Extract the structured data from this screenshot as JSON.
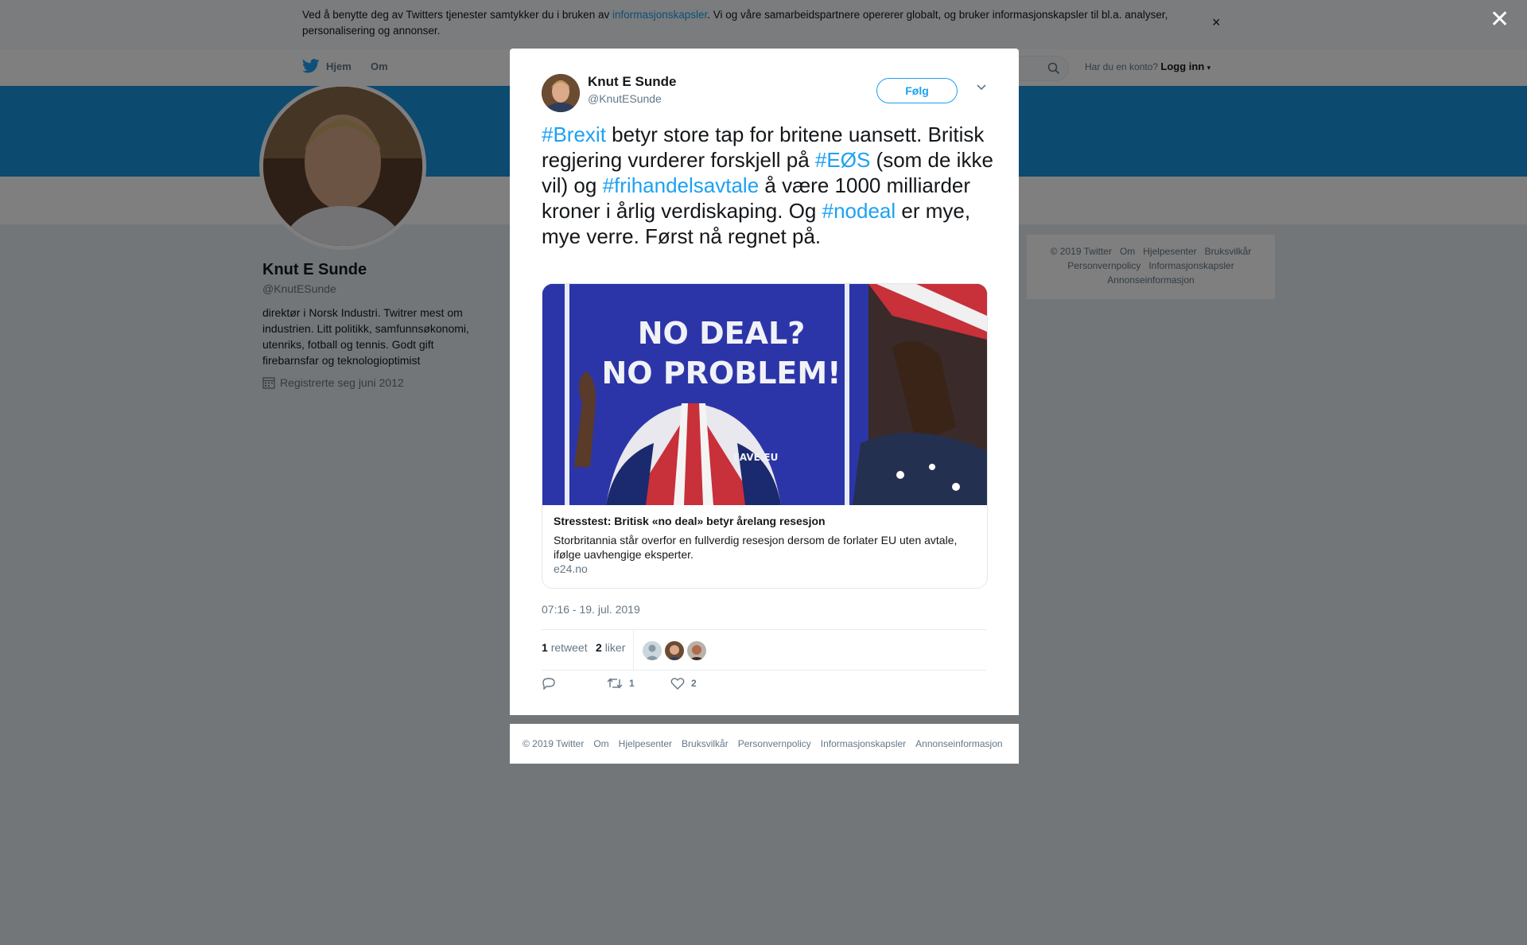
{
  "cookie_bar": {
    "text_before": "Ved å benytte deg av Twitters tjenester samtykker du i bruken av ",
    "link": "informasjonskapsler",
    "text_after": ". Vi og våre samarbeidspartnere opererer globalt, og bruker informasjonskapsler til bl.a. analyser, personalisering og annonser.",
    "close": "×"
  },
  "topnav": {
    "home": "Hjem",
    "about": "Om",
    "account_prompt": "Har du en konto?",
    "login": "Logg inn"
  },
  "profile": {
    "name": "Knut E Sunde",
    "handle": "@KnutESunde",
    "bio": "direktør i Norsk Industri. Twitrer mest om industrien. Litt politikk, samfunnsøkonomi, utenriks, fotball og tennis. Godt gift firebarnsfar og teknologioptimist",
    "joined": "Registrerte seg juni 2012"
  },
  "side_footer": {
    "links": [
      "© 2019 Twitter",
      "Om",
      "Hjelpesenter",
      "Bruksvilkår",
      "Personvernpolicy",
      "Informasjonskapsler",
      "Annonseinformasjon"
    ]
  },
  "overlay": {
    "close": "✕"
  },
  "tweet": {
    "author_name": "Knut E Sunde",
    "author_handle": "@KnutESunde",
    "follow_label": "Følg",
    "text_parts": {
      "h1": "#Brexit",
      "t1": " betyr store tap for britene uansett. Britisk regjering vurderer forskjell på ",
      "h2": "#EØS",
      "t2": " (som de ikke vil) og ",
      "h3": "#frihandelsavtale",
      "t3": " å være 1000 milliarder kroner i årlig verdiskaping. Og ",
      "h4": "#nodeal",
      "t4": " er mye, mye verre. Først nå regnet på."
    },
    "card": {
      "image_line1": "NO DEAL?",
      "image_line2": "NO PROBLEM!",
      "image_footer": "EAVE.EU",
      "title": "Stresstest: Britisk «no deal» betyr årelang resesjon",
      "description": "Storbritannia står overfor en fullverdig resesjon dersom de forlater EU uten avtale, ifølge uavhengige eksperter.",
      "domain": "e24.no"
    },
    "timestamp": "07:16 - 19. jul. 2019",
    "retweets_count": "1",
    "retweets_label": "retweet",
    "likes_count": "2",
    "likes_label": "liker",
    "action_retweet_count": "1",
    "action_like_count": "2"
  },
  "modal_footer": {
    "links": [
      "© 2019 Twitter",
      "Om",
      "Hjelpesenter",
      "Bruksvilkår",
      "Personvernpolicy",
      "Informasjonskapsler",
      "Annonseinformasjon"
    ]
  },
  "colors": {
    "twitter_blue": "#1da1f2",
    "banner": "#1b95e0",
    "muted": "#657786"
  },
  "icons": [
    "twitter-bird-icon",
    "search-icon",
    "calendar-icon",
    "close-icon",
    "chevron-down-icon",
    "reply-icon",
    "retweet-icon",
    "heart-icon"
  ]
}
